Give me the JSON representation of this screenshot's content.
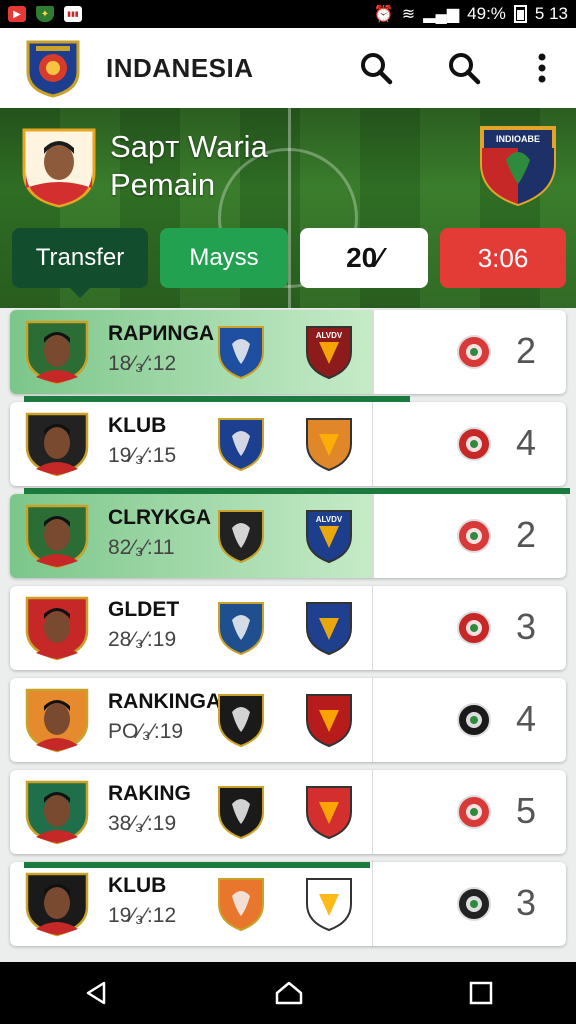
{
  "status_bar": {
    "battery": "49:%",
    "time": "5 13",
    "flag_badge": "▮▮▮",
    "wifi_glyph": "≋",
    "signal_glyph": "▂▄▆"
  },
  "app_bar": {
    "title": "INDANESIA",
    "icons": [
      "search-icon",
      "search-icon",
      "more-vert-icon"
    ]
  },
  "hero": {
    "title_line1": "Sapт Waria",
    "title_line2": "Pemain",
    "crest_text": "INDIOABE"
  },
  "stats": {
    "transfer": "Transfer",
    "mayss": "Mayss",
    "percent": "20⁄",
    "time": "3:06"
  },
  "rows": [
    {
      "name": "RAРИNGA",
      "score": "18⁄₃⁄:12",
      "count": "2",
      "highlighted": true,
      "badge1_color": "#1e4fa0",
      "badge2_color": "#8e1b1b",
      "mini_color": "#d83a3a",
      "avatar_color": "#2b6d34",
      "badge2_text": "ALVDV"
    },
    {
      "name": "KLUB",
      "score": "19⁄₃⁄:15",
      "count": "4",
      "highlighted": false,
      "badge1_color": "#1d3f8f",
      "badge2_color": "#e0872a",
      "mini_color": "#c62828",
      "avatar_color": "#222222",
      "badge2_text": ""
    },
    {
      "name": "CLRYKGA",
      "score": "82⁄₃⁄:11",
      "count": "2",
      "highlighted": true,
      "badge1_color": "#222222",
      "badge2_color": "#1c3e8c",
      "mini_color": "#d83a3a",
      "avatar_color": "#2b6d34",
      "badge2_text": "ALVDV"
    },
    {
      "name": "GLDET",
      "score": "28⁄₃⁄:19",
      "count": "3",
      "highlighted": false,
      "badge1_color": "#1f4f8f",
      "badge2_color": "#1f3f8f",
      "mini_color": "#c62828",
      "avatar_color": "#c62828",
      "badge2_text": ""
    },
    {
      "name": "RANKINGA",
      "score": "PO⁄₃⁄:19",
      "count": "4",
      "highlighted": false,
      "badge1_color": "#1a1a1a",
      "badge2_color": "#b71c1c",
      "mini_color": "#1a1a1a",
      "avatar_color": "#e68a2e",
      "badge2_text": ""
    },
    {
      "name": "RAKING",
      "score": "38⁄₃⁄:19",
      "count": "5",
      "highlighted": false,
      "badge1_color": "#1a1a1a",
      "badge2_color": "#d32f2f",
      "mini_color": "#d83a3a",
      "avatar_color": "#1f6f4a",
      "badge2_text": ""
    },
    {
      "name": "KLUB",
      "score": "19⁄₃⁄:12",
      "count": "3",
      "highlighted": false,
      "badge1_color": "#e8762c",
      "badge2_color": "#ffffff",
      "mini_color": "#222222",
      "avatar_color": "#1a1a1a",
      "badge2_text": ""
    }
  ],
  "nav": {
    "icons": [
      "back-icon",
      "home-icon",
      "recents-icon"
    ]
  },
  "colors": {
    "accent_dark": "#124d2e",
    "accent_green": "#22a150",
    "accent_red": "#e33c37",
    "highlight_green": "#7cc68a"
  }
}
